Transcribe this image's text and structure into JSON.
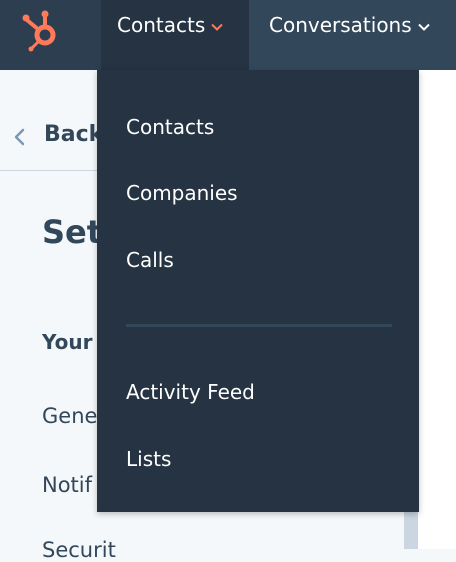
{
  "nav": {
    "contacts_label": "Contacts",
    "conversations_label": "Conversations"
  },
  "dropdown": {
    "items": [
      {
        "label": "Contacts"
      },
      {
        "label": "Companies"
      },
      {
        "label": "Calls"
      },
      {
        "label": "Activity Feed"
      },
      {
        "label": "Lists"
      }
    ]
  },
  "settings": {
    "back_label": "Back",
    "title_partial": "Set",
    "section_partial": "Your",
    "items_partial": [
      "Gene",
      "Notif",
      "Securit"
    ]
  },
  "colors": {
    "nav_bg": "#2d3e50",
    "dropdown_bg": "#253342",
    "accent_orange": "#ff7a59",
    "text_dark": "#33475b"
  }
}
